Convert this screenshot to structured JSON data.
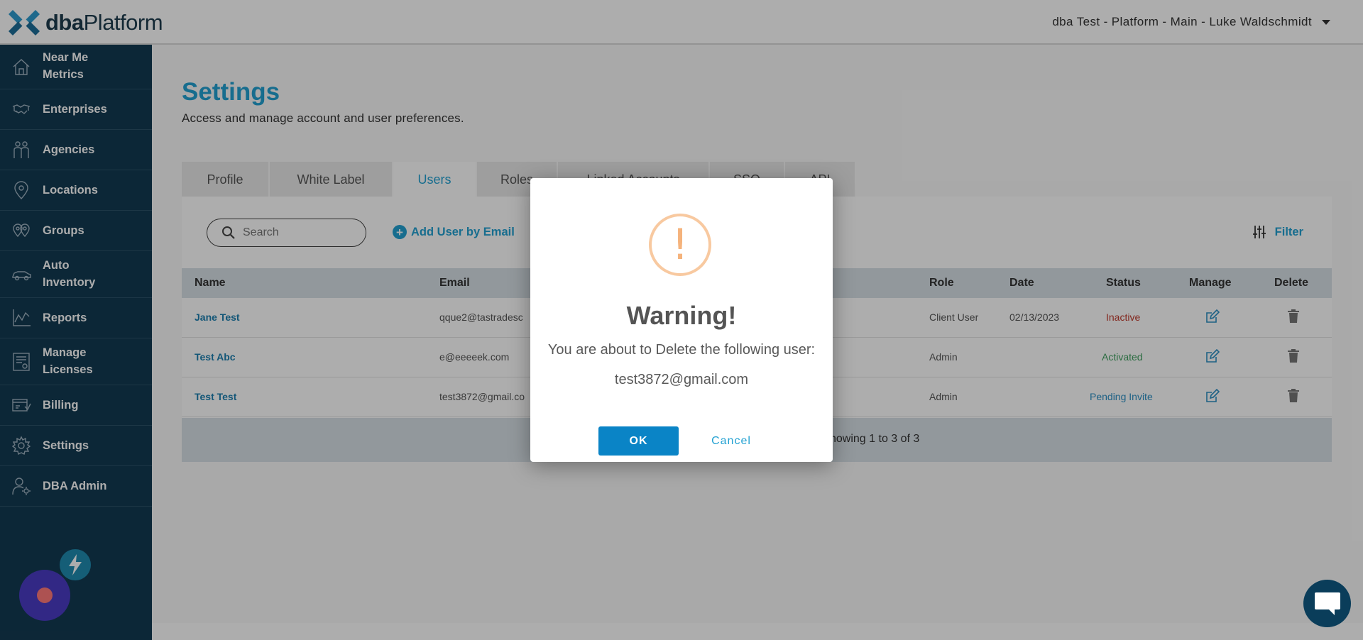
{
  "brand": {
    "logo_bold": "dba",
    "logo_rest": "Platform"
  },
  "header": {
    "account": "dba Test - Platform - Main - Luke Waldschmidt"
  },
  "sidebar": {
    "items": [
      {
        "label_line1": "Near Me",
        "label_line2": "Metrics",
        "icon": "house-icon"
      },
      {
        "label_line1": "Enterprises",
        "icon": "handshake-icon"
      },
      {
        "label_line1": "Agencies",
        "icon": "people-icon"
      },
      {
        "label_line1": "Locations",
        "icon": "map-pin-icon"
      },
      {
        "label_line1": "Groups",
        "icon": "multi-pin-icon"
      },
      {
        "label_line1": "Auto",
        "label_line2": "Inventory",
        "icon": "car-icon"
      },
      {
        "label_line1": "Reports",
        "icon": "line-chart-icon"
      },
      {
        "label_line1": "Manage",
        "label_line2": "Licenses",
        "icon": "license-icon"
      },
      {
        "label_line1": "Billing",
        "icon": "billing-icon"
      },
      {
        "label_line1": "Settings",
        "icon": "gear-icon"
      },
      {
        "label_line1": "DBA Admin",
        "icon": "admin-icon"
      }
    ]
  },
  "page": {
    "title": "Settings",
    "subtitle": "Access and manage account and user preferences."
  },
  "tabs": [
    {
      "label": "Profile"
    },
    {
      "label": "White Label"
    },
    {
      "label": "Users",
      "active": true
    },
    {
      "label": "Roles"
    },
    {
      "label": "Linked Accounts"
    },
    {
      "label": "SSO"
    },
    {
      "label": "API"
    }
  ],
  "toolbar": {
    "search_placeholder": "Search",
    "add_user_label": "Add User by Email",
    "filter_label": "Filter"
  },
  "table": {
    "columns": {
      "name": "Name",
      "email": "Email",
      "role": "Role",
      "date": "Date",
      "status": "Status",
      "manage": "Manage",
      "delete": "Delete"
    },
    "rows": [
      {
        "name": "Jane Test",
        "email": "qque2@tastradesc",
        "role": "Client User",
        "date": "02/13/2023",
        "status": "Inactive"
      },
      {
        "name": "Test Abc",
        "email": "e@eeeeek.com",
        "role": "Admin",
        "date": "",
        "status": "Activated"
      },
      {
        "name": "Test Test",
        "email": "test3872@gmail.co",
        "role": "Admin",
        "date": "",
        "status": "Pending Invite"
      }
    ],
    "footer": "howing 1 to 3 of 3"
  },
  "modal": {
    "icon_glyph": "!",
    "title": "Warning!",
    "message": "You are about to Delete the following user:",
    "email": "test3872@gmail.com",
    "ok_label": "OK",
    "cancel_label": "Cancel"
  },
  "colors": {
    "brand_blue": "#22a1d2",
    "sidebar_bg": "#133a51",
    "ok_button": "#0a84c6",
    "warning_orange": "#f8c9a0"
  }
}
